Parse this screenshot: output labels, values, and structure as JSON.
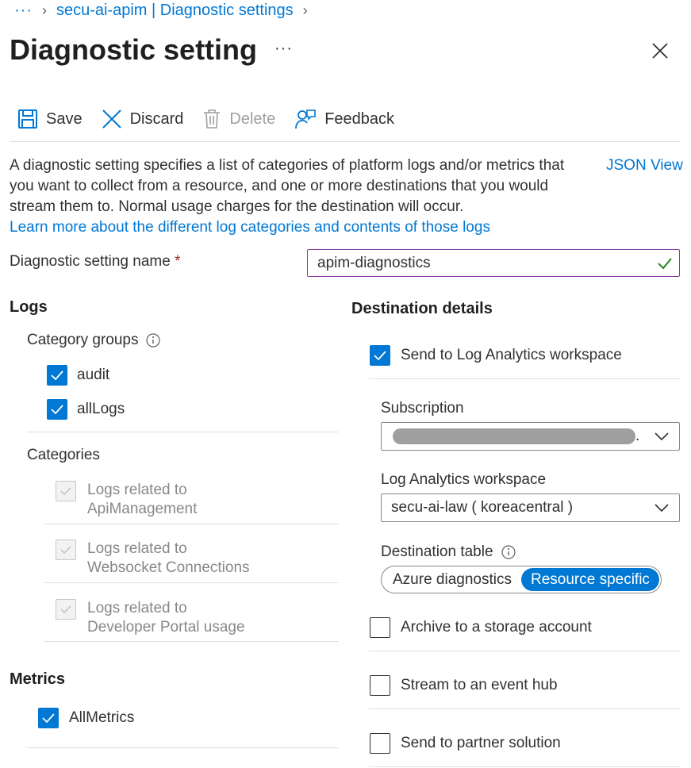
{
  "breadcrumb": {
    "ellipsis": "···",
    "item": "secu-ai-apim | Diagnostic settings"
  },
  "page": {
    "title": "Diagnostic setting",
    "more": "···"
  },
  "toolbar": {
    "save": "Save",
    "discard": "Discard",
    "delete": "Delete",
    "feedback": "Feedback"
  },
  "description": {
    "text": "A diagnostic setting specifies a list of categories of platform logs and/or metrics that you want to collect from a resource, and one or more destinations that you would stream them to. Normal usage charges for the destination will occur.",
    "link": "Learn more about the different log categories and contents of those logs",
    "json_view": "JSON View"
  },
  "name_field": {
    "label": "Diagnostic setting name",
    "required_mark": "*",
    "value": "apim-diagnostics"
  },
  "logs": {
    "heading": "Logs",
    "category_groups_label": "Category groups",
    "groups": [
      {
        "label": "audit",
        "checked": true
      },
      {
        "label": "allLogs",
        "checked": true
      }
    ],
    "categories_label": "Categories",
    "categories": [
      {
        "line1": "Logs related to",
        "line2": "ApiManagement"
      },
      {
        "line1": "Logs related to",
        "line2": "Websocket Connections"
      },
      {
        "line1": "Logs related to",
        "line2": "Developer Portal usage"
      }
    ]
  },
  "metrics": {
    "heading": "Metrics",
    "items": [
      {
        "label": "AllMetrics",
        "checked": true
      }
    ]
  },
  "destination": {
    "heading": "Destination details",
    "log_analytics": {
      "label": "Send to Log Analytics workspace",
      "checked": true
    },
    "subscription_label": "Subscription",
    "subscription_value": "",
    "subscription_suffix": ".",
    "workspace_label": "Log Analytics workspace",
    "workspace_value": "secu-ai-law ( koreacentral )",
    "table_label": "Destination table",
    "table_options": [
      "Azure diagnostics",
      "Resource specific"
    ],
    "table_selected": "Resource specific",
    "archive": {
      "label": "Archive to a storage account",
      "checked": false
    },
    "event_hub": {
      "label": "Stream to an event hub",
      "checked": false
    },
    "partner": {
      "label": "Send to partner solution",
      "checked": false
    }
  },
  "colors": {
    "accent": "#0078d4",
    "input_border": "#8a3aa6",
    "valid_check": "#107c10"
  }
}
